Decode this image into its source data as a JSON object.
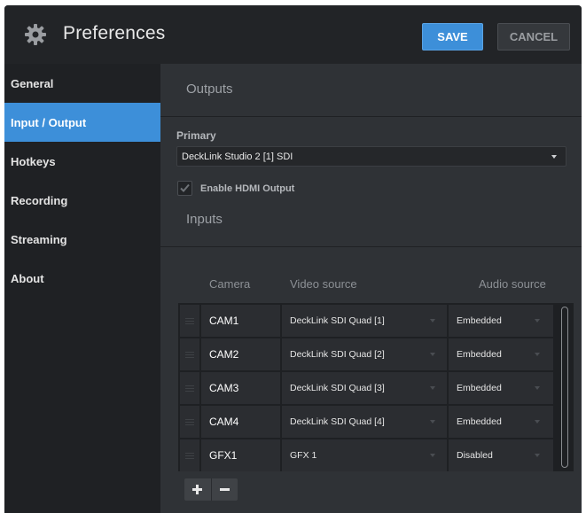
{
  "window": {
    "title": "Preferences",
    "save_label": "SAVE",
    "cancel_label": "CANCEL"
  },
  "sidebar": {
    "items": [
      {
        "label": "General",
        "active": false
      },
      {
        "label": "Input / Output",
        "active": true
      },
      {
        "label": "Hotkeys",
        "active": false
      },
      {
        "label": "Recording",
        "active": false
      },
      {
        "label": "Streaming",
        "active": false
      },
      {
        "label": "About",
        "active": false
      }
    ]
  },
  "outputs": {
    "heading": "Outputs",
    "primary_label": "Primary",
    "primary_value": "DeckLink Studio 2 [1] SDI",
    "hdmi_label": "Enable HDMI Output",
    "hdmi_checked": true
  },
  "inputs": {
    "heading": "Inputs",
    "columns": [
      "Camera",
      "Video source",
      "Audio source"
    ],
    "rows": [
      {
        "camera": "CAM1",
        "video": "DeckLink SDI Quad [1]",
        "audio": "Embedded"
      },
      {
        "camera": "CAM2",
        "video": "DeckLink SDI Quad [2]",
        "audio": "Embedded"
      },
      {
        "camera": "CAM3",
        "video": "DeckLink SDI Quad [3]",
        "audio": "Embedded"
      },
      {
        "camera": "CAM4",
        "video": "DeckLink SDI Quad [4]",
        "audio": "Embedded"
      },
      {
        "camera": "GFX1",
        "video": "GFX 1",
        "audio": "Disabled"
      }
    ]
  },
  "colors": {
    "accent": "#3d8fd9",
    "background": "#2f3236",
    "sidebar": "#1f2124"
  }
}
